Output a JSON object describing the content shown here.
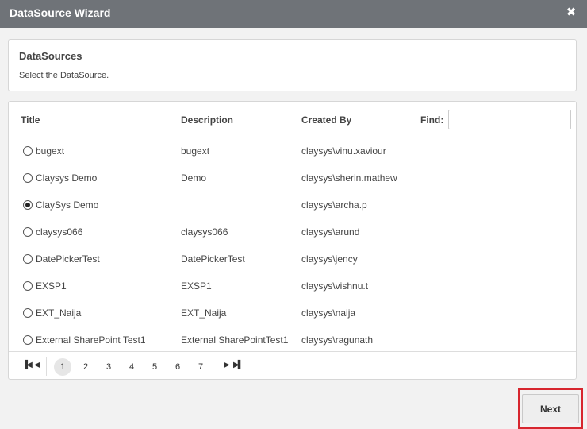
{
  "dialog": {
    "title": "DataSource Wizard",
    "close_glyph": "✖",
    "close_icon": "close-icon"
  },
  "info": {
    "heading": "DataSources",
    "subtext": "Select the DataSource."
  },
  "grid": {
    "columns": {
      "title": "Title",
      "description": "Description",
      "created_by": "Created By"
    },
    "find": {
      "label": "Find:",
      "value": "",
      "placeholder": ""
    },
    "rows": [
      {
        "title": "bugext",
        "description": "bugext",
        "created_by": "claysys\\vinu.xaviour",
        "selected": false
      },
      {
        "title": "Claysys Demo",
        "description": "Demo",
        "created_by": "claysys\\sherin.mathew",
        "selected": false
      },
      {
        "title": "ClaySys Demo",
        "description": "",
        "created_by": "claysys\\archa.p",
        "selected": true
      },
      {
        "title": "claysys066",
        "description": "claysys066",
        "created_by": "claysys\\arund",
        "selected": false
      },
      {
        "title": "DatePickerTest",
        "description": "DatePickerTest",
        "created_by": "claysys\\jency",
        "selected": false
      },
      {
        "title": "EXSP1",
        "description": "EXSP1",
        "created_by": "claysys\\vishnu.t",
        "selected": false
      },
      {
        "title": "EXT_Naija",
        "description": "EXT_Naija",
        "created_by": "claysys\\naija",
        "selected": false
      },
      {
        "title": "External SharePoint Test1",
        "description": "External SharePointTest1",
        "created_by": "claysys\\ragunath",
        "selected": false
      }
    ]
  },
  "pager": {
    "first_glyph": "▐◀",
    "prev_glyph": "◀",
    "next_glyph": "▶",
    "last_glyph": "▶▌",
    "pages": [
      "1",
      "2",
      "3",
      "4",
      "5",
      "6",
      "7"
    ],
    "current": "1"
  },
  "footer": {
    "next_label": "Next",
    "highlight_color": "#d7262e"
  }
}
